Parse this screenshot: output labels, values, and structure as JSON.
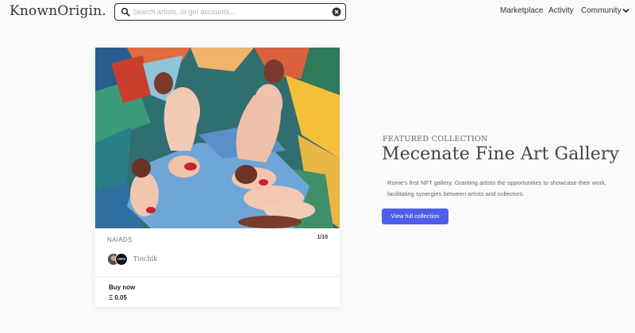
{
  "header": {
    "logo": "KnownOrigin.",
    "search": {
      "placeholder": "Search artists, or get accounts...",
      "icon": "search-icon",
      "clear_icon": "close-circle-icon"
    },
    "nav": [
      {
        "label": "Marketplace"
      },
      {
        "label": "Activity"
      },
      {
        "label": "Community"
      }
    ]
  },
  "card": {
    "title": "NAIADS",
    "edition": "1/10",
    "artist": "Tinchik",
    "avatar_badge": "ORPH",
    "buy_label": "Buy now",
    "price": "Ξ 0.05"
  },
  "featured": {
    "label": "FEATURED COLLECTION",
    "title": "Mecenate Fine Art Gallery",
    "description": "Rome's first NFT gallery. Granting artists the opportunities to showcase their work, facilitating synergies between artists and collectors.",
    "button_label": "View full collection",
    "button_color": "#4f5ee8"
  }
}
